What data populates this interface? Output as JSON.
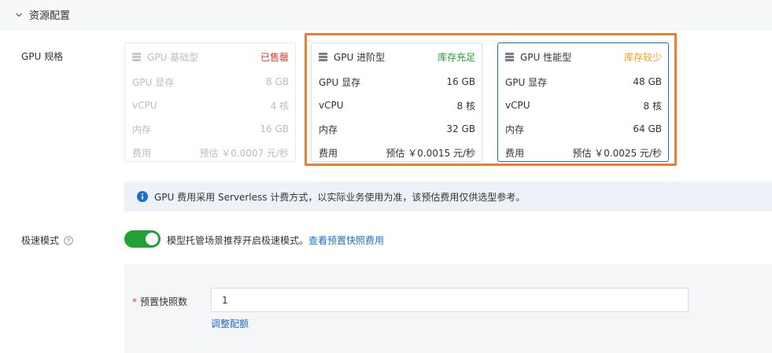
{
  "section": {
    "title": "资源配置",
    "icon": "chevron-down-icon"
  },
  "gpu_spec": {
    "label": "GPU 规格",
    "cards": [
      {
        "title": "GPU 基础型",
        "stock": "已售罄",
        "stock_color": "#e03c31",
        "state": "disabled",
        "rows": [
          {
            "k": "GPU 显存",
            "v": "8 GB"
          },
          {
            "k": "vCPU",
            "v": "4 核"
          },
          {
            "k": "内存",
            "v": "16 GB"
          },
          {
            "k": "费用",
            "v": "预估 ￥0.0007 元/秒"
          }
        ]
      },
      {
        "title": "GPU 进阶型",
        "stock": "库存充足",
        "stock_color": "#21a035",
        "state": "normal",
        "rows": [
          {
            "k": "GPU 显存",
            "v": "16 GB"
          },
          {
            "k": "vCPU",
            "v": "8 核"
          },
          {
            "k": "内存",
            "v": "32 GB"
          },
          {
            "k": "费用",
            "v": "预估 ￥0.0015 元/秒"
          }
        ]
      },
      {
        "title": "GPU 性能型",
        "stock": "库存较少",
        "stock_color": "#f0a020",
        "state": "selected",
        "rows": [
          {
            "k": "GPU 显存",
            "v": "48 GB"
          },
          {
            "k": "vCPU",
            "v": "8 核"
          },
          {
            "k": "内存",
            "v": "64 GB"
          },
          {
            "k": "费用",
            "v": "预估 ￥0.0025 元/秒"
          }
        ]
      }
    ]
  },
  "info": {
    "text": "GPU 费用采用 Serverless 计费方式，以实际业务使用为准，该预估费用仅供选型参考。",
    "icon": "info-icon"
  },
  "speed_mode": {
    "label": "极速模式",
    "enabled": true,
    "description": "模型托管场景推荐开启极速模式。",
    "link": "查看预置快照费用"
  },
  "snapshot": {
    "required_mark": "*",
    "label": "预置快照数",
    "value": "1",
    "adjust_link": "调整配额"
  },
  "colors": {
    "accent": "#1a6fc9",
    "toggle_on": "#21a035",
    "highlight": "#ed7d31"
  }
}
